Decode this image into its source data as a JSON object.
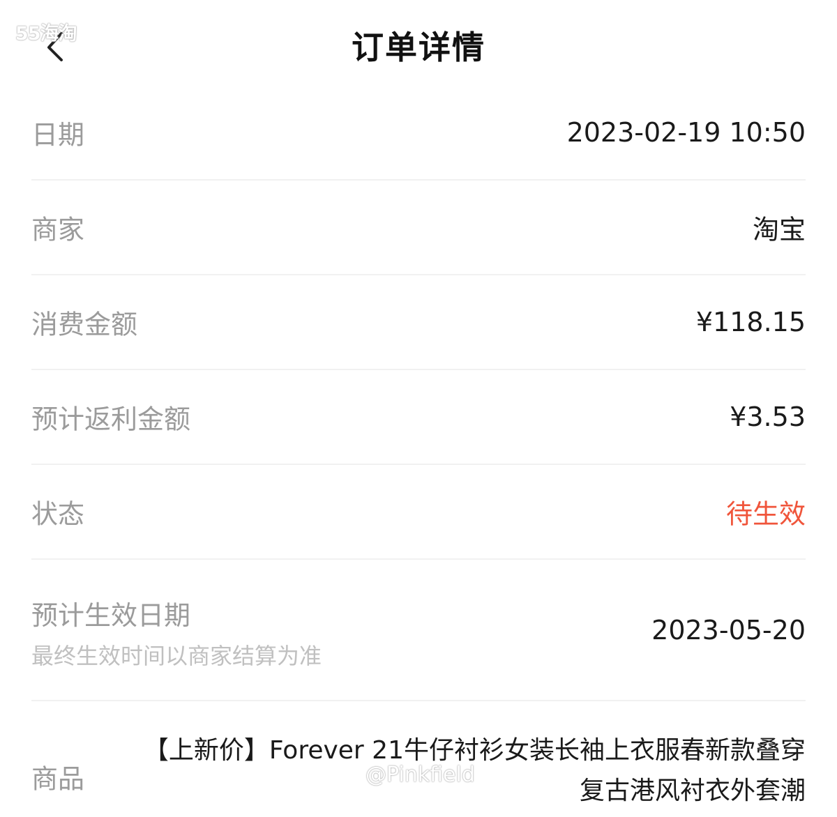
{
  "watermark_top": "55海淘",
  "header": {
    "title": "订单详情"
  },
  "rows": [
    {
      "label": "日期",
      "value": "2023-02-19 10:50"
    },
    {
      "label": "商家",
      "value": "淘宝"
    },
    {
      "label": "消费金额",
      "value": "¥118.15"
    },
    {
      "label": "预计返利金额",
      "value": "¥3.53"
    },
    {
      "label": "状态",
      "value": "待生效"
    },
    {
      "label": "预计生效日期",
      "sublabel": "最终生效时间以商家结算为准",
      "value": "2023-05-20"
    },
    {
      "label": "商品",
      "value": "【上新价】Forever 21牛仔衬衫女装长袖上衣服春新款叠穿复古港风衬衣外套潮"
    }
  ],
  "colors": {
    "status": "#f0553b",
    "label": "#9b9b9b",
    "divider": "#f1f1f1"
  },
  "watermark_bottom": "@Pinkfield",
  "icons": {
    "back": "chevron-left-icon"
  }
}
